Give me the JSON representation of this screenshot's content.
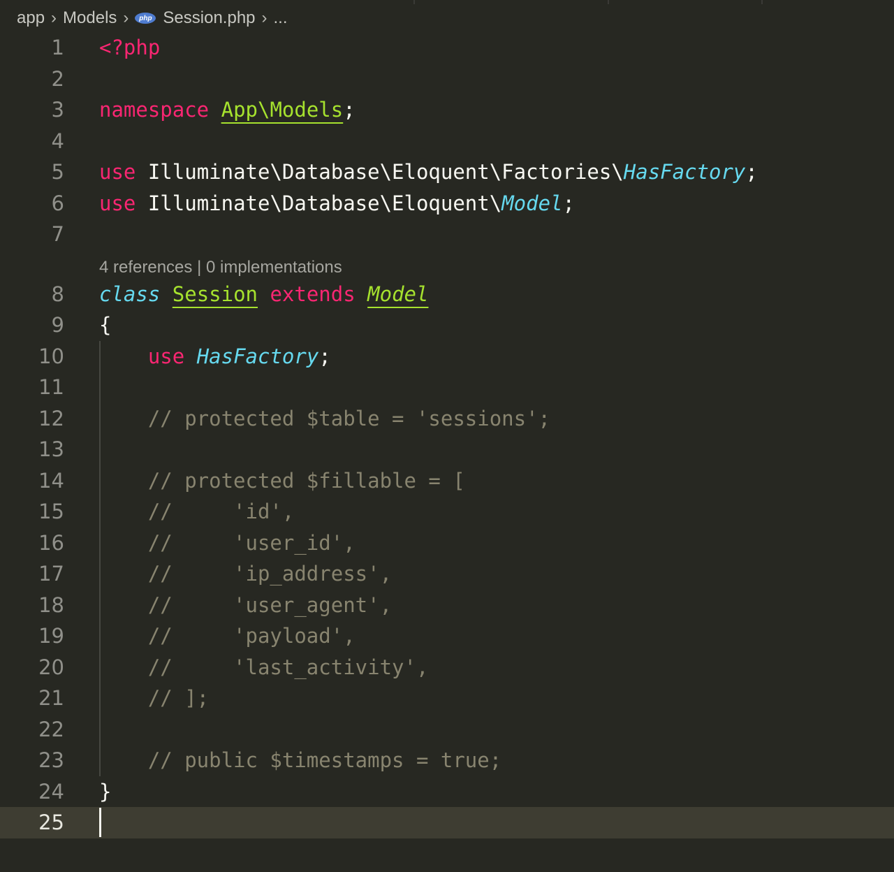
{
  "breadcrumb": {
    "items": [
      "app",
      "Models",
      "Session.php",
      "..."
    ],
    "php_badge": "php"
  },
  "codelens": "4 references | 0 implementations",
  "lines": [
    {
      "n": "1",
      "tokens": [
        {
          "t": "<?php",
          "c": "kw"
        }
      ]
    },
    {
      "n": "2",
      "tokens": []
    },
    {
      "n": "3",
      "tokens": [
        {
          "t": "namespace",
          "c": "kw"
        },
        {
          "t": " ",
          "c": "plain"
        },
        {
          "t": "App\\Models",
          "c": "cls"
        },
        {
          "t": ";",
          "c": "plain"
        }
      ]
    },
    {
      "n": "4",
      "tokens": []
    },
    {
      "n": "5",
      "tokens": [
        {
          "t": "use",
          "c": "kw"
        },
        {
          "t": " Illuminate\\Database\\Eloquent\\Factories\\",
          "c": "plain"
        },
        {
          "t": "HasFactory",
          "c": "type"
        },
        {
          "t": ";",
          "c": "plain"
        }
      ]
    },
    {
      "n": "6",
      "tokens": [
        {
          "t": "use",
          "c": "kw"
        },
        {
          "t": " Illuminate\\Database\\Eloquent\\",
          "c": "plain"
        },
        {
          "t": "Model",
          "c": "type"
        },
        {
          "t": ";",
          "c": "plain"
        }
      ]
    },
    {
      "n": "7",
      "tokens": []
    },
    {
      "n": "8",
      "lens": true,
      "tokens": [
        {
          "t": "class",
          "c": "type"
        },
        {
          "t": " ",
          "c": "plain"
        },
        {
          "t": "Session",
          "c": "cls"
        },
        {
          "t": " ",
          "c": "plain"
        },
        {
          "t": "extends",
          "c": "kw"
        },
        {
          "t": " ",
          "c": "plain"
        },
        {
          "t": "Model",
          "c": "cls-i"
        }
      ]
    },
    {
      "n": "9",
      "tokens": [
        {
          "t": "{",
          "c": "plain"
        }
      ]
    },
    {
      "n": "10",
      "guide": true,
      "tokens": [
        {
          "t": "    ",
          "c": "plain"
        },
        {
          "t": "use",
          "c": "kw"
        },
        {
          "t": " ",
          "c": "plain"
        },
        {
          "t": "HasFactory",
          "c": "type"
        },
        {
          "t": ";",
          "c": "plain"
        }
      ]
    },
    {
      "n": "11",
      "guide": true,
      "tokens": []
    },
    {
      "n": "12",
      "guide": true,
      "tokens": [
        {
          "t": "    // protected $table = 'sessions';",
          "c": "cmt"
        }
      ]
    },
    {
      "n": "13",
      "guide": true,
      "tokens": []
    },
    {
      "n": "14",
      "guide": true,
      "tokens": [
        {
          "t": "    // protected $fillable = [",
          "c": "cmt"
        }
      ]
    },
    {
      "n": "15",
      "guide": true,
      "tokens": [
        {
          "t": "    //     'id',",
          "c": "cmt"
        }
      ]
    },
    {
      "n": "16",
      "guide": true,
      "tokens": [
        {
          "t": "    //     'user_id',",
          "c": "cmt"
        }
      ]
    },
    {
      "n": "17",
      "guide": true,
      "tokens": [
        {
          "t": "    //     'ip_address',",
          "c": "cmt"
        }
      ]
    },
    {
      "n": "18",
      "guide": true,
      "tokens": [
        {
          "t": "    //     'user_agent',",
          "c": "cmt"
        }
      ]
    },
    {
      "n": "19",
      "guide": true,
      "tokens": [
        {
          "t": "    //     'payload',",
          "c": "cmt"
        }
      ]
    },
    {
      "n": "20",
      "guide": true,
      "tokens": [
        {
          "t": "    //     'last_activity',",
          "c": "cmt"
        }
      ]
    },
    {
      "n": "21",
      "guide": true,
      "tokens": [
        {
          "t": "    // ];",
          "c": "cmt"
        }
      ]
    },
    {
      "n": "22",
      "guide": true,
      "tokens": []
    },
    {
      "n": "23",
      "guide": true,
      "tokens": [
        {
          "t": "    // public $timestamps = true;",
          "c": "cmt"
        }
      ]
    },
    {
      "n": "24",
      "tokens": [
        {
          "t": "}",
          "c": "plain"
        }
      ]
    },
    {
      "n": "25",
      "current": true,
      "tokens": []
    }
  ]
}
